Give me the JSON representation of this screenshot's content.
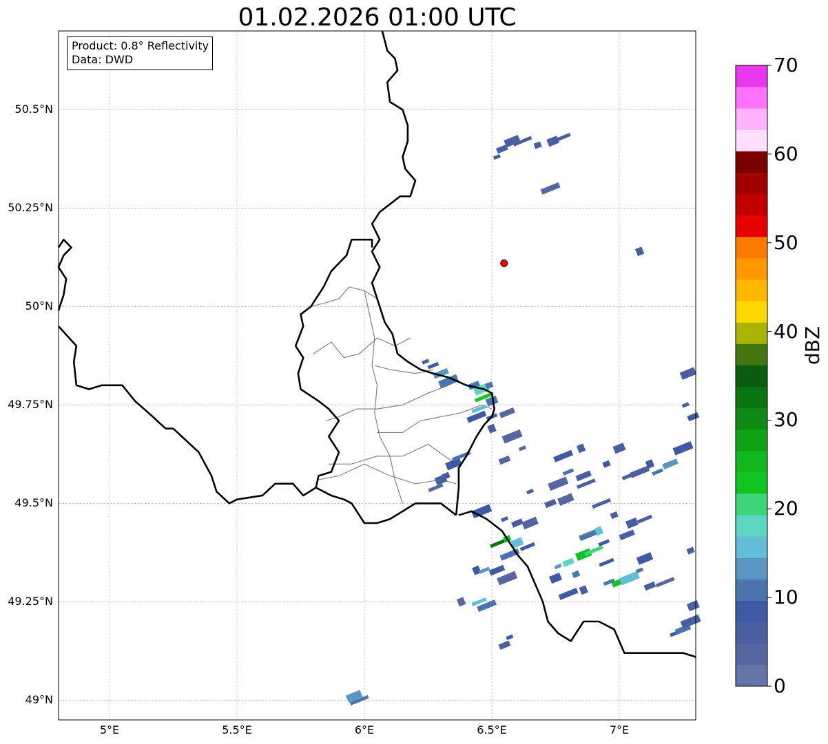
{
  "title": "01.02.2026 01:00 UTC",
  "info_box": {
    "product": "Product: 0.8° Reflectivity",
    "data": "Data: DWD"
  },
  "map": {
    "lon_range": [
      4.8,
      7.3
    ],
    "lat_range": [
      48.95,
      50.7
    ],
    "lat_ticks": [
      {
        "value": 50.5,
        "label": "50.5°N"
      },
      {
        "value": 50.25,
        "label": "50.25°N"
      },
      {
        "value": 50.0,
        "label": "50°N"
      },
      {
        "value": 49.75,
        "label": "49.75°N"
      },
      {
        "value": 49.5,
        "label": "49.5°N"
      },
      {
        "value": 49.25,
        "label": "49.25°N"
      },
      {
        "value": 49.0,
        "label": "49°N"
      }
    ],
    "lon_ticks": [
      {
        "value": 5.0,
        "label": "5°E"
      },
      {
        "value": 5.5,
        "label": "5.5°E"
      },
      {
        "value": 6.0,
        "label": "6°E"
      },
      {
        "value": 6.5,
        "label": "6.5°E"
      },
      {
        "value": 7.0,
        "label": "7°E"
      }
    ],
    "grid": true,
    "radar_site": {
      "lon": 6.548,
      "lat": 50.11,
      "color": "#ff0000"
    },
    "borders": [
      [
        [
          6.07,
          50.7
        ],
        [
          6.09,
          50.65
        ],
        [
          6.12,
          50.63
        ],
        [
          6.13,
          50.6
        ],
        [
          6.09,
          50.57
        ],
        [
          6.1,
          50.52
        ],
        [
          6.15,
          50.5
        ],
        [
          6.17,
          50.46
        ],
        [
          6.17,
          50.42
        ],
        [
          6.15,
          50.38
        ],
        [
          6.16,
          50.35
        ],
        [
          6.2,
          50.32
        ],
        [
          6.18,
          50.28
        ],
        [
          6.14,
          50.28
        ],
        [
          6.1,
          50.26
        ],
        [
          6.06,
          50.24
        ],
        [
          6.03,
          50.21
        ],
        [
          6.06,
          50.17
        ],
        [
          6.03,
          50.14
        ],
        [
          6.06,
          50.1
        ],
        [
          6.03,
          50.06
        ],
        [
          6.05,
          50.02
        ],
        [
          6.08,
          49.96
        ],
        [
          6.11,
          49.93
        ],
        [
          6.13,
          49.88
        ],
        [
          6.17,
          49.86
        ],
        [
          6.22,
          49.84
        ],
        [
          6.27,
          49.83
        ],
        [
          6.33,
          49.82
        ],
        [
          6.4,
          49.8
        ],
        [
          6.47,
          49.79
        ],
        [
          6.5,
          49.78
        ],
        [
          6.51,
          49.74
        ],
        [
          6.5,
          49.72
        ],
        [
          6.47,
          49.7
        ],
        [
          6.44,
          49.67
        ],
        [
          6.4,
          49.62
        ],
        [
          6.37,
          49.59
        ],
        [
          6.37,
          49.54
        ],
        [
          6.36,
          49.47
        ]
      ],
      [
        [
          6.37,
          49.47
        ],
        [
          6.42,
          49.48
        ],
        [
          6.48,
          49.46
        ],
        [
          6.54,
          49.43
        ],
        [
          6.6,
          49.37
        ],
        [
          6.64,
          49.34
        ],
        [
          6.7,
          49.25
        ],
        [
          6.72,
          49.2
        ],
        [
          6.76,
          49.17
        ],
        [
          6.81,
          49.15
        ],
        [
          6.86,
          49.2
        ],
        [
          6.92,
          49.2
        ],
        [
          6.98,
          49.18
        ],
        [
          7.02,
          49.12
        ],
        [
          7.07,
          49.12
        ],
        [
          7.13,
          49.12
        ],
        [
          7.2,
          49.12
        ],
        [
          7.25,
          49.12
        ],
        [
          7.3,
          49.11
        ]
      ],
      [
        [
          6.36,
          49.47
        ],
        [
          6.3,
          49.5
        ],
        [
          6.25,
          49.5
        ],
        [
          6.2,
          49.5
        ],
        [
          6.15,
          49.48
        ],
        [
          6.1,
          49.46
        ],
        [
          6.05,
          49.45
        ],
        [
          6.0,
          49.45
        ],
        [
          5.98,
          49.47
        ],
        [
          5.95,
          49.5
        ],
        [
          5.92,
          49.51
        ],
        [
          5.87,
          49.52
        ],
        [
          5.81,
          49.54
        ],
        [
          5.82,
          49.57
        ],
        [
          5.87,
          49.58
        ],
        [
          5.9,
          49.63
        ],
        [
          5.86,
          49.67
        ],
        [
          5.9,
          49.71
        ],
        [
          5.86,
          49.74
        ],
        [
          5.82,
          49.76
        ],
        [
          5.75,
          49.79
        ],
        [
          5.74,
          49.83
        ],
        [
          5.76,
          49.87
        ],
        [
          5.73,
          49.9
        ],
        [
          5.76,
          49.95
        ],
        [
          5.75,
          49.98
        ],
        [
          5.79,
          50.0
        ],
        [
          5.84,
          50.05
        ],
        [
          5.87,
          50.09
        ],
        [
          5.93,
          50.13
        ],
        [
          5.95,
          50.17
        ],
        [
          6.03,
          50.17
        ],
        [
          6.03,
          50.15
        ]
      ],
      [
        [
          5.81,
          49.54
        ],
        [
          5.76,
          49.52
        ],
        [
          5.72,
          49.55
        ],
        [
          5.65,
          49.55
        ],
        [
          5.6,
          49.52
        ],
        [
          5.5,
          49.51
        ],
        [
          5.47,
          49.5
        ],
        [
          5.42,
          49.53
        ],
        [
          5.4,
          49.57
        ],
        [
          5.35,
          49.63
        ],
        [
          5.3,
          49.66
        ],
        [
          5.25,
          49.69
        ],
        [
          5.22,
          49.69
        ],
        [
          5.17,
          49.72
        ],
        [
          5.1,
          49.76
        ],
        [
          5.05,
          49.8
        ],
        [
          4.97,
          49.8
        ],
        [
          4.92,
          49.79
        ],
        [
          4.87,
          49.8
        ],
        [
          4.86,
          49.86
        ],
        [
          4.87,
          49.9
        ],
        [
          4.8,
          49.95
        ]
      ],
      [
        [
          4.8,
          50.15
        ],
        [
          4.82,
          50.17
        ],
        [
          4.85,
          50.15
        ],
        [
          4.82,
          50.13
        ],
        [
          4.8,
          50.1
        ],
        [
          4.83,
          50.07
        ],
        [
          4.82,
          50.03
        ],
        [
          4.8,
          49.99
        ]
      ]
    ],
    "admin_lines": [
      [
        [
          5.79,
          50.0
        ],
        [
          5.85,
          50.01
        ],
        [
          5.9,
          50.02
        ],
        [
          5.94,
          50.05
        ],
        [
          6.0,
          50.04
        ],
        [
          6.05,
          50.02
        ]
      ],
      [
        [
          5.8,
          49.88
        ],
        [
          5.87,
          49.91
        ],
        [
          5.92,
          49.87
        ],
        [
          5.98,
          49.88
        ],
        [
          6.05,
          49.92
        ],
        [
          6.12,
          49.9
        ],
        [
          6.18,
          49.92
        ]
      ],
      [
        [
          6.0,
          50.04
        ],
        [
          6.02,
          49.98
        ],
        [
          6.04,
          49.92
        ],
        [
          6.03,
          49.85
        ],
        [
          6.05,
          49.8
        ],
        [
          6.04,
          49.73
        ],
        [
          6.06,
          49.67
        ],
        [
          6.1,
          49.62
        ],
        [
          6.12,
          49.56
        ],
        [
          6.15,
          49.5
        ]
      ],
      [
        [
          6.04,
          49.85
        ],
        [
          6.1,
          49.84
        ],
        [
          6.2,
          49.83
        ],
        [
          6.27,
          49.84
        ]
      ],
      [
        [
          5.85,
          49.71
        ],
        [
          5.9,
          49.72
        ],
        [
          5.97,
          49.74
        ],
        [
          6.05,
          49.74
        ],
        [
          6.15,
          49.75
        ],
        [
          6.25,
          49.78
        ],
        [
          6.33,
          49.8
        ]
      ],
      [
        [
          6.05,
          49.68
        ],
        [
          6.15,
          49.68
        ],
        [
          6.22,
          49.71
        ],
        [
          6.3,
          49.72
        ],
        [
          6.38,
          49.73
        ],
        [
          6.46,
          49.75
        ],
        [
          6.5,
          49.74
        ]
      ],
      [
        [
          5.86,
          49.6
        ],
        [
          5.95,
          49.6
        ],
        [
          6.05,
          49.62
        ],
        [
          6.15,
          49.62
        ],
        [
          6.25,
          49.65
        ],
        [
          6.36,
          49.6
        ]
      ],
      [
        [
          5.82,
          49.56
        ],
        [
          5.9,
          49.57
        ],
        [
          6.0,
          49.6
        ],
        [
          6.1,
          49.57
        ],
        [
          6.2,
          49.55
        ],
        [
          6.3,
          49.56
        ],
        [
          6.36,
          49.55
        ]
      ]
    ],
    "echoes": [
      {
        "lon": 6.52,
        "lat": 50.38,
        "dbz": 5
      },
      {
        "lon": 6.54,
        "lat": 50.4,
        "dbz": 5
      },
      {
        "lon": 6.58,
        "lat": 50.42,
        "dbz": 5
      },
      {
        "lon": 6.62,
        "lat": 50.42,
        "dbz": 5
      },
      {
        "lon": 6.68,
        "lat": 50.41,
        "dbz": 5
      },
      {
        "lon": 6.74,
        "lat": 50.42,
        "dbz": 5
      },
      {
        "lon": 6.78,
        "lat": 50.43,
        "dbz": 5
      },
      {
        "lon": 6.73,
        "lat": 50.3,
        "dbz": 4
      },
      {
        "lon": 7.08,
        "lat": 50.14,
        "dbz": 5
      },
      {
        "lon": 6.27,
        "lat": 49.85,
        "dbz": 8
      },
      {
        "lon": 6.3,
        "lat": 49.83,
        "dbz": 14
      },
      {
        "lon": 6.33,
        "lat": 49.81,
        "dbz": 10
      },
      {
        "lon": 6.24,
        "lat": 49.86,
        "dbz": 6
      },
      {
        "lon": 6.43,
        "lat": 49.8,
        "dbz": 10
      },
      {
        "lon": 6.46,
        "lat": 49.79,
        "dbz": 18
      },
      {
        "lon": 6.47,
        "lat": 49.77,
        "dbz": 24
      },
      {
        "lon": 6.49,
        "lat": 49.8,
        "dbz": 12
      },
      {
        "lon": 6.5,
        "lat": 49.76,
        "dbz": 10
      },
      {
        "lon": 6.45,
        "lat": 49.74,
        "dbz": 16
      },
      {
        "lon": 6.44,
        "lat": 49.72,
        "dbz": 8
      },
      {
        "lon": 6.5,
        "lat": 49.69,
        "dbz": 6
      },
      {
        "lon": 6.5,
        "lat": 49.72,
        "dbz": 6
      },
      {
        "lon": 6.56,
        "lat": 49.73,
        "dbz": 4
      },
      {
        "lon": 6.58,
        "lat": 49.67,
        "dbz": 4
      },
      {
        "lon": 6.62,
        "lat": 49.64,
        "dbz": 4
      },
      {
        "lon": 6.55,
        "lat": 49.61,
        "dbz": 4
      },
      {
        "lon": 6.35,
        "lat": 49.6,
        "dbz": 8
      },
      {
        "lon": 6.38,
        "lat": 49.62,
        "dbz": 12
      },
      {
        "lon": 6.32,
        "lat": 49.57,
        "dbz": 8
      },
      {
        "lon": 6.3,
        "lat": 49.56,
        "dbz": 6
      },
      {
        "lon": 6.28,
        "lat": 49.54,
        "dbz": 4
      },
      {
        "lon": 6.78,
        "lat": 49.62,
        "dbz": 8
      },
      {
        "lon": 6.85,
        "lat": 49.64,
        "dbz": 6
      },
      {
        "lon": 6.8,
        "lat": 49.58,
        "dbz": 10
      },
      {
        "lon": 6.86,
        "lat": 49.57,
        "dbz": 6
      },
      {
        "lon": 6.76,
        "lat": 49.55,
        "dbz": 4
      },
      {
        "lon": 6.65,
        "lat": 49.53,
        "dbz": 5
      },
      {
        "lon": 6.73,
        "lat": 49.5,
        "dbz": 6
      },
      {
        "lon": 6.79,
        "lat": 49.51,
        "dbz": 4
      },
      {
        "lon": 6.87,
        "lat": 49.55,
        "dbz": 6
      },
      {
        "lon": 6.95,
        "lat": 49.6,
        "dbz": 8
      },
      {
        "lon": 7.0,
        "lat": 49.64,
        "dbz": 6
      },
      {
        "lon": 7.04,
        "lat": 49.57,
        "dbz": 5
      },
      {
        "lon": 7.08,
        "lat": 49.58,
        "dbz": 6
      },
      {
        "lon": 7.12,
        "lat": 49.6,
        "dbz": 8
      },
      {
        "lon": 7.15,
        "lat": 49.58,
        "dbz": 10
      },
      {
        "lon": 7.2,
        "lat": 49.6,
        "dbz": 14
      },
      {
        "lon": 7.25,
        "lat": 49.64,
        "dbz": 8
      },
      {
        "lon": 7.26,
        "lat": 49.75,
        "dbz": 6
      },
      {
        "lon": 7.29,
        "lat": 49.72,
        "dbz": 8
      },
      {
        "lon": 7.27,
        "lat": 49.83,
        "dbz": 6
      },
      {
        "lon": 6.93,
        "lat": 49.5,
        "dbz": 6
      },
      {
        "lon": 6.98,
        "lat": 49.47,
        "dbz": 6
      },
      {
        "lon": 7.05,
        "lat": 49.45,
        "dbz": 6
      },
      {
        "lon": 7.1,
        "lat": 49.46,
        "dbz": 5
      },
      {
        "lon": 6.88,
        "lat": 49.42,
        "dbz": 10
      },
      {
        "lon": 6.92,
        "lat": 49.43,
        "dbz": 16
      },
      {
        "lon": 6.94,
        "lat": 49.4,
        "dbz": 8
      },
      {
        "lon": 7.03,
        "lat": 49.42,
        "dbz": 5
      },
      {
        "lon": 6.46,
        "lat": 49.48,
        "dbz": 8
      },
      {
        "lon": 6.55,
        "lat": 49.46,
        "dbz": 6
      },
      {
        "lon": 6.6,
        "lat": 49.45,
        "dbz": 6
      },
      {
        "lon": 6.65,
        "lat": 49.45,
        "dbz": 4
      },
      {
        "lon": 6.53,
        "lat": 49.4,
        "dbz": 32
      },
      {
        "lon": 6.56,
        "lat": 49.41,
        "dbz": 24
      },
      {
        "lon": 6.6,
        "lat": 49.4,
        "dbz": 16
      },
      {
        "lon": 6.64,
        "lat": 49.39,
        "dbz": 8
      },
      {
        "lon": 6.57,
        "lat": 49.37,
        "dbz": 12
      },
      {
        "lon": 6.44,
        "lat": 49.33,
        "dbz": 8
      },
      {
        "lon": 6.47,
        "lat": 49.33,
        "dbz": 14
      },
      {
        "lon": 6.52,
        "lat": 49.33,
        "dbz": 8
      },
      {
        "lon": 6.56,
        "lat": 49.31,
        "dbz": 4
      },
      {
        "lon": 6.76,
        "lat": 49.34,
        "dbz": 14
      },
      {
        "lon": 6.8,
        "lat": 49.35,
        "dbz": 18
      },
      {
        "lon": 6.86,
        "lat": 49.37,
        "dbz": 24
      },
      {
        "lon": 6.9,
        "lat": 49.38,
        "dbz": 20
      },
      {
        "lon": 6.83,
        "lat": 49.32,
        "dbz": 12
      },
      {
        "lon": 6.75,
        "lat": 49.31,
        "dbz": 8
      },
      {
        "lon": 6.95,
        "lat": 49.35,
        "dbz": 8
      },
      {
        "lon": 6.8,
        "lat": 49.27,
        "dbz": 8
      },
      {
        "lon": 6.86,
        "lat": 49.28,
        "dbz": 6
      },
      {
        "lon": 6.96,
        "lat": 49.3,
        "dbz": 12
      },
      {
        "lon": 7.0,
        "lat": 49.3,
        "dbz": 24
      },
      {
        "lon": 7.04,
        "lat": 49.31,
        "dbz": 16
      },
      {
        "lon": 7.08,
        "lat": 49.33,
        "dbz": 10
      },
      {
        "lon": 7.12,
        "lat": 49.29,
        "dbz": 6
      },
      {
        "lon": 7.1,
        "lat": 49.36,
        "dbz": 8
      },
      {
        "lon": 7.18,
        "lat": 49.3,
        "dbz": 4
      },
      {
        "lon": 7.28,
        "lat": 49.38,
        "dbz": 6
      },
      {
        "lon": 7.29,
        "lat": 49.24,
        "dbz": 5
      },
      {
        "lon": 6.45,
        "lat": 49.25,
        "dbz": 16
      },
      {
        "lon": 6.48,
        "lat": 49.24,
        "dbz": 12
      },
      {
        "lon": 6.38,
        "lat": 49.25,
        "dbz": 4
      },
      {
        "lon": 7.22,
        "lat": 49.17,
        "dbz": 8
      },
      {
        "lon": 7.25,
        "lat": 49.18,
        "dbz": 10
      },
      {
        "lon": 7.28,
        "lat": 49.2,
        "dbz": 6
      },
      {
        "lon": 6.57,
        "lat": 49.16,
        "dbz": 8
      },
      {
        "lon": 6.55,
        "lat": 49.14,
        "dbz": 5
      },
      {
        "lon": 5.96,
        "lat": 49.01,
        "dbz": 14
      },
      {
        "lon": 5.98,
        "lat": 49.0,
        "dbz": 10
      }
    ]
  },
  "colorbar": {
    "label": "dBZ",
    "min": 0,
    "max": 70,
    "ticks": [
      {
        "value": 0,
        "label": "0"
      },
      {
        "value": 10,
        "label": "10"
      },
      {
        "value": 20,
        "label": "20"
      },
      {
        "value": 30,
        "label": "30"
      },
      {
        "value": 40,
        "label": "40"
      },
      {
        "value": 50,
        "label": "50"
      },
      {
        "value": 60,
        "label": "60"
      },
      {
        "value": 70,
        "label": "70"
      }
    ],
    "colors": [
      "#6675a8",
      "#56679f",
      "#4a5fa0",
      "#3f5aa3",
      "#4b73ad",
      "#5a95c3",
      "#63bcd8",
      "#5cd6c0",
      "#3dd47a",
      "#12c421",
      "#12b91c",
      "#0fa215",
      "#0f8a15",
      "#0b7412",
      "#0a5d0e",
      "#427611",
      "#aab407",
      "#fed800",
      "#feb800",
      "#fe9900",
      "#fe7b00",
      "#e60000",
      "#c10000",
      "#a30000",
      "#7b0000",
      "#ffdfff",
      "#ffb3ff",
      "#ff72ff",
      "#e837ed"
    ]
  }
}
